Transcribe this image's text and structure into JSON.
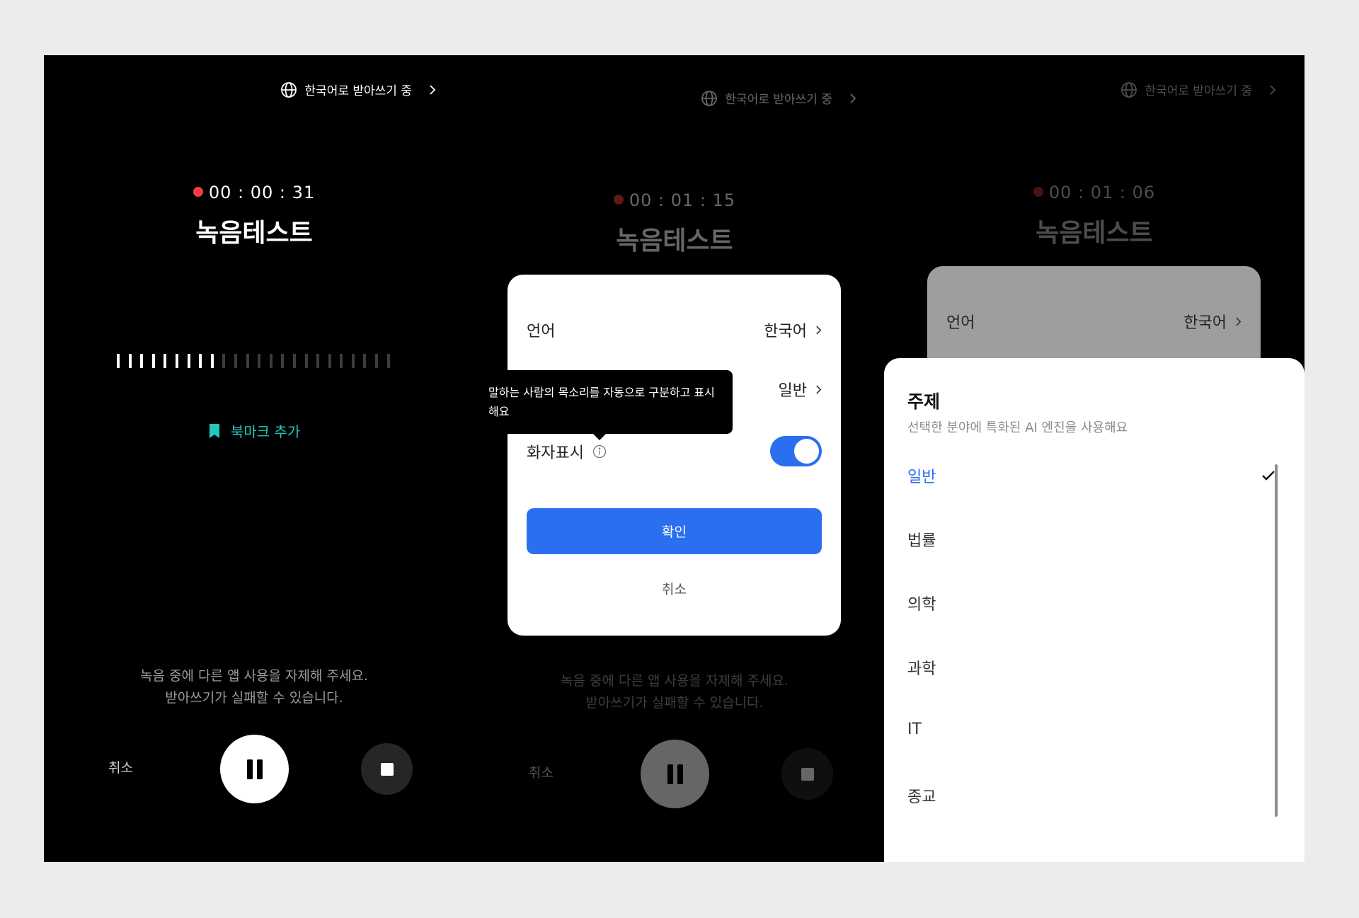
{
  "status_bar": {
    "language_label": "한국어로 받아쓰기 중"
  },
  "screens": [
    {
      "timer": "00 : 00 : 31",
      "title": "녹음테스트"
    },
    {
      "timer": "00 : 01 : 15",
      "title": "녹음테스트"
    },
    {
      "timer": "00 : 01 : 06",
      "title": "녹음테스트"
    }
  ],
  "recorder": {
    "bookmark_label": "북마크 추가",
    "notice_line1": "녹음 중에 다른 앱 사용을 자제해 주세요.",
    "notice_line2": "받아쓰기가 실패할 수 있습니다.",
    "cancel_label": "취소",
    "waveform": {
      "active_bars": 9,
      "total_bars": 24
    }
  },
  "settings_dialog": {
    "language_label": "언어",
    "language_value": "한국어",
    "topic_value": "일반",
    "speaker_label": "화자표시",
    "speaker_enabled": true,
    "tooltip": "말하는 사람의 목소리를 자동으로 구분하고 표시해요",
    "confirm_label": "확인",
    "cancel_label": "취소"
  },
  "topic_sheet": {
    "title": "주제",
    "subtitle": "선택한 분야에 특화된 AI 엔진을 사용해요",
    "options": [
      "일반",
      "법률",
      "의학",
      "과학",
      "IT",
      "종교"
    ],
    "selected": "일반"
  },
  "colors": {
    "accent_blue": "#2a6ff0",
    "record_red": "#f03f3f",
    "bookmark_teal": "#21c9bd",
    "background": "#000000"
  }
}
